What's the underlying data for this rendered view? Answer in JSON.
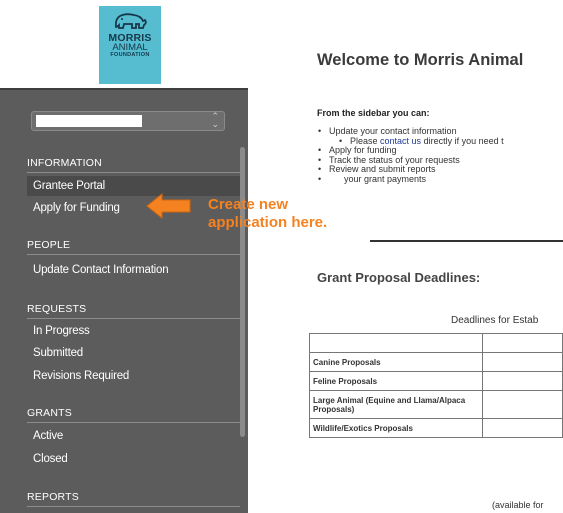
{
  "logo": {
    "line1": "MORRIS",
    "line2": "ANIMAL",
    "line3": "FOUNDATION"
  },
  "sidebar": {
    "sections": [
      {
        "heading": "INFORMATION",
        "items": [
          {
            "label": "Grantee Portal",
            "active": true
          },
          {
            "label": "Apply for Funding",
            "active": false
          }
        ]
      },
      {
        "heading": "PEOPLE",
        "items": [
          {
            "label": "Update Contact Information",
            "active": false
          }
        ]
      },
      {
        "heading": "REQUESTS",
        "items": [
          {
            "label": "In Progress"
          },
          {
            "label": "Submitted"
          },
          {
            "label": "Revisions Required"
          }
        ]
      },
      {
        "heading": "GRANTS",
        "items": [
          {
            "label": "Active"
          },
          {
            "label": "Closed"
          }
        ]
      },
      {
        "heading": "REPORTS",
        "items": []
      }
    ]
  },
  "callout": {
    "line1": "Create new",
    "line2": "application here."
  },
  "main": {
    "welcome": "Welcome to Morris Animal",
    "intro": "From the sidebar you can:",
    "bullets": {
      "b1": "Update your contact information",
      "b1_sub_pre": "Please ",
      "b1_sub_link": "contact us",
      "b1_sub_post": " directly if you need t",
      "b2": "Apply for funding",
      "b3": "Track the status of your requests",
      "b4": "Review and submit reports",
      "b5": "      your grant payments"
    },
    "grant_heading": "Grant Proposal Deadlines:",
    "deadline_caption": "Deadlines for Estab",
    "table_rows": [
      "",
      "Canine Proposals",
      "Feline Proposals",
      "Large Animal (Equine and Llama/Alpaca Proposals)",
      "Wildlife/Exotics Proposals"
    ],
    "available": "(available for"
  },
  "colors": {
    "sidebar_bg": "#5c5c5c",
    "accent_orange": "#f58220",
    "logo_bg": "#56bcd0",
    "link": "#1f3a93"
  }
}
